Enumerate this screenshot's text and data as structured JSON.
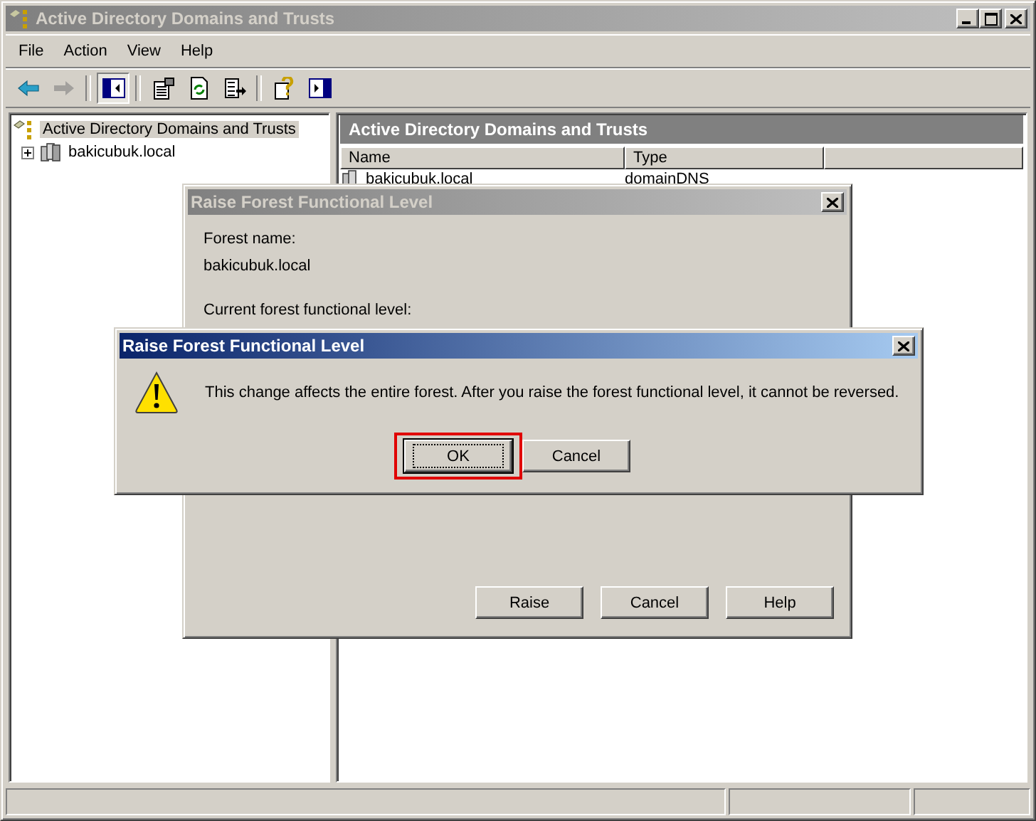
{
  "window": {
    "title": "Active Directory Domains and Trusts",
    "active": false
  },
  "menu": [
    {
      "label": "File"
    },
    {
      "label": "Action"
    },
    {
      "label": "View"
    },
    {
      "label": "Help"
    }
  ],
  "toolbar": [
    {
      "kind": "back",
      "disabled": false,
      "pressed": false
    },
    {
      "kind": "forward",
      "disabled": true,
      "pressed": false
    },
    {
      "kind": "tree",
      "disabled": false,
      "pressed": true
    },
    {
      "kind": "properties",
      "disabled": false,
      "pressed": false
    },
    {
      "kind": "refresh",
      "disabled": false,
      "pressed": false
    },
    {
      "kind": "export",
      "disabled": false,
      "pressed": false
    },
    {
      "kind": "help",
      "disabled": false,
      "pressed": false
    },
    {
      "kind": "actionpane",
      "disabled": false,
      "pressed": false
    }
  ],
  "tree": {
    "items": [
      {
        "label": "Active Directory Domains and Trusts",
        "selected": true,
        "children": [
          {
            "label": "bakicubuk.local",
            "selected": false,
            "expanded": false
          }
        ]
      }
    ]
  },
  "content": {
    "title": "Active Directory Domains and Trusts",
    "columns": [
      "Name",
      "Type"
    ],
    "rows": [
      {
        "name": "bakicubuk.local",
        "type": "domainDNS"
      }
    ]
  },
  "back_dialog": {
    "title": "Raise Forest Functional Level",
    "active": false,
    "forest_name_label": "Forest name:",
    "forest_name": "bakicubuk.local",
    "current_level_label": "Current forest functional level:",
    "buttons": [
      {
        "label": "Raise"
      },
      {
        "label": "Cancel"
      },
      {
        "label": "Help"
      }
    ]
  },
  "alert": {
    "title": "Raise Forest Functional Level",
    "active": true,
    "message": "This change affects the entire forest. After you raise the forest functional level, it cannot be reversed.",
    "buttons": [
      {
        "label": "OK",
        "default": true,
        "highlighted": true
      },
      {
        "label": "Cancel",
        "default": false,
        "highlighted": false
      }
    ]
  }
}
